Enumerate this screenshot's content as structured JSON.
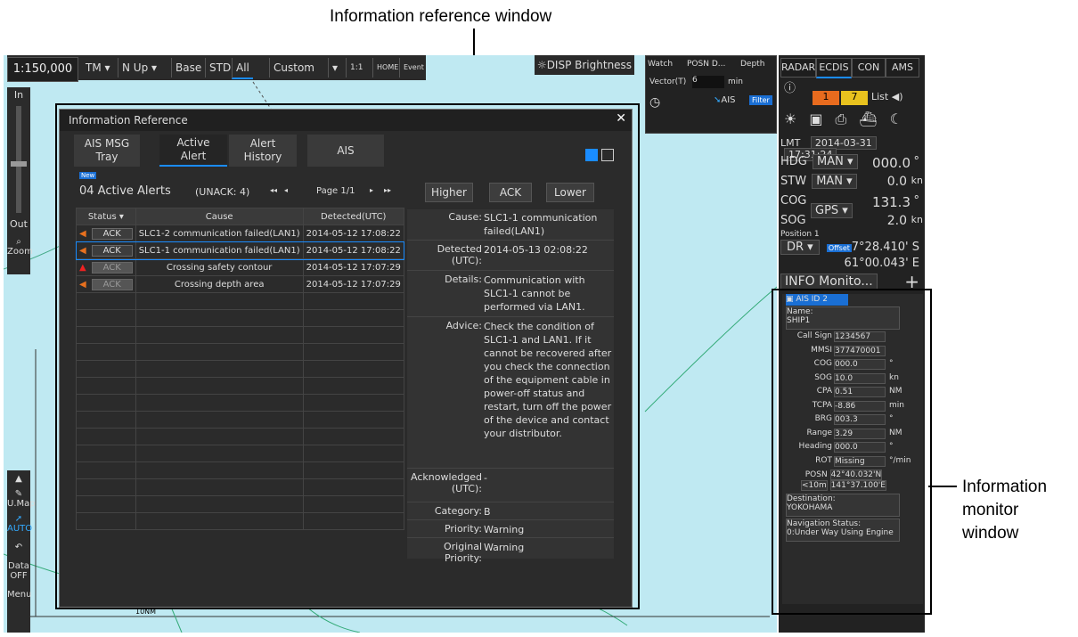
{
  "callouts": {
    "info_reference": "Information reference window",
    "info_monitor_1": "Information",
    "info_monitor_2": "monitor",
    "info_monitor_3": "window"
  },
  "topbar": {
    "scale": "1:150,000",
    "tm": "TM",
    "nup": "N Up",
    "base": "Base",
    "std": "STD",
    "all": "All",
    "custom": "Custom",
    "brightness": "DISP Brightness",
    "home": "HOME",
    "event": "Event"
  },
  "leftbar": {
    "in": "In",
    "out": "Out",
    "zoom": "Zoom",
    "umap": "U.Map",
    "auto": "AUTO",
    "data": "Data",
    "off": "OFF",
    "menu": "Menu",
    "scale_bar": "10NM"
  },
  "watch": {
    "tab_watch": "Watch",
    "tab_posn": "POSN D...",
    "tab_depth": "Depth",
    "vector_label": "Vector(T)",
    "vector_value": "6",
    "vector_unit": "min",
    "ais": "AIS",
    "filter": "Filter"
  },
  "right_panel": {
    "tabs": [
      "RADAR",
      "ECDIS",
      "CON",
      "AMS"
    ],
    "alert_orange": "1",
    "alert_yellow": "7",
    "list": "List",
    "lmt": "LMT",
    "date": "2014-03-31",
    "time": "17:31:24",
    "hdg_label": "HDG",
    "hdg_src": "MAN",
    "hdg_val": "000.0",
    "hdg_unit": "°",
    "stw_label": "STW",
    "stw_src": "MAN",
    "stw_val": "0.0",
    "stw_unit": "kn",
    "cog_label": "COG",
    "cog_val": "131.3",
    "cog_unit": "°",
    "sog_label": "SOG",
    "sog_src": "GPS",
    "sog_val": "2.0",
    "sog_unit": "kn",
    "position": "Position 1",
    "dr": "DR",
    "offset": "Offset",
    "lat": "7°28.410' S",
    "lon": "61°00.043' E",
    "info_monitor": "INFO Monito...",
    "plus": "+"
  },
  "info_monitor": {
    "ais_id": "AIS ID 2",
    "name_label": "Name:",
    "name": "SHIP1",
    "rows": [
      {
        "label": "Call Sign",
        "value": "1234567",
        "unit": ""
      },
      {
        "label": "MMSI",
        "value": "377470001",
        "unit": ""
      },
      {
        "label": "COG",
        "value": "000.0",
        "unit": "°"
      },
      {
        "label": "SOG",
        "value": "10.0",
        "unit": "kn"
      },
      {
        "label": "CPA",
        "value": "0.51",
        "unit": "NM"
      },
      {
        "label": "TCPA",
        "value": "-8.86",
        "unit": "min"
      },
      {
        "label": "BRG",
        "value": "003.3",
        "unit": "°"
      },
      {
        "label": "Range",
        "value": "3.29",
        "unit": "NM"
      },
      {
        "label": "Heading",
        "value": "000.0",
        "unit": "°"
      },
      {
        "label": "ROT",
        "value": "Missing",
        "unit": "°/min"
      }
    ],
    "posn_label": "POSN",
    "posn_lat": "42°40.032'N",
    "posn_acc": "<10m",
    "posn_lon": "141°37.100'E",
    "dest_label": "Destination:",
    "dest": "YOKOHAMA",
    "nav_label": "Navigation Status:",
    "nav": "0:Under Way Using Engine"
  },
  "window": {
    "title": "Information Reference",
    "close": "✕",
    "tab_ais_msg": "AIS MSG\nTray",
    "tab_active": "Active\nAlert",
    "tab_history": "Alert\nHistory",
    "tab_ais": "AIS",
    "new_badge": "New",
    "active_count": "04 Active Alerts",
    "unack": "(UNACK: 4)",
    "page": "Page 1/1",
    "higher": "Higher",
    "ack": "ACK",
    "lower": "Lower",
    "col_status": "Status",
    "col_cause": "Cause",
    "col_detected": "Detected(UTC)",
    "alerts": [
      {
        "status": "ACK",
        "cause": "SLC1-2 communication failed(LAN1)",
        "detected": "2014-05-12 17:08:22"
      },
      {
        "status": "ACK",
        "cause": "SLC1-1 communication failed(LAN1)",
        "detected": "2014-05-12 17:08:22"
      },
      {
        "status": "ACK",
        "cause": "Crossing safety contour",
        "detected": "2014-05-12 17:07:29"
      },
      {
        "status": "ACK",
        "cause": "Crossing depth area",
        "detected": "2014-05-12 17:07:29"
      }
    ],
    "detail": {
      "cause_label": "Cause:",
      "cause": "SLC1-1 communication failed(LAN1)",
      "detected_label": "Detected (UTC):",
      "detected": "2014-05-13 02:08:22",
      "details_label": "Details:",
      "details": "Communication with SLC1-1 cannot be performed via LAN1.",
      "advice_label": "Advice:",
      "advice": "Check the condition of SLC1-1 and LAN1. If it cannot be recovered after you check the connection of the equipment cable in power-off status and restart, turn off the power of the device and contact your distributor.",
      "ack_label": "Acknowledged (UTC):",
      "ack": "-",
      "category_label": "Category:",
      "category": "B",
      "priority_label": "Priority:",
      "priority": "Warning",
      "orig_label": "Original Priority:",
      "orig": "Warning"
    }
  }
}
